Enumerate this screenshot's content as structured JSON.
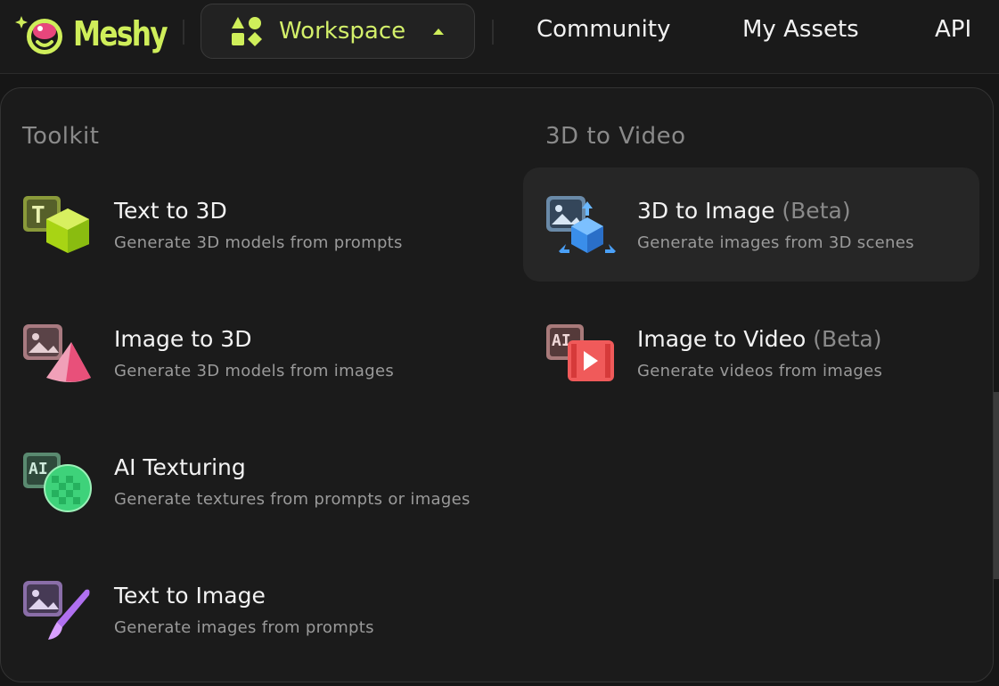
{
  "app": {
    "brand": "Meshy",
    "accent_color": "#cfee5a"
  },
  "nav": {
    "workspace_label": "Workspace",
    "links": [
      "Community",
      "My Assets",
      "API"
    ]
  },
  "menu": {
    "toolkit": {
      "title": "Toolkit",
      "items": [
        {
          "title": "Text to 3D",
          "beta": "",
          "desc": "Generate 3D models from prompts",
          "icon": "text-to-3d-icon"
        },
        {
          "title": "Image to 3D",
          "beta": "",
          "desc": "Generate 3D models from images",
          "icon": "image-to-3d-icon"
        },
        {
          "title": "AI Texturing",
          "beta": "",
          "desc": "Generate textures from prompts or images",
          "icon": "ai-texturing-icon"
        },
        {
          "title": "Text to Image",
          "beta": "",
          "desc": "Generate images from prompts",
          "icon": "text-to-image-icon"
        }
      ]
    },
    "video": {
      "title": "3D to Video",
      "items": [
        {
          "title": "3D to Image",
          "beta": "(Beta)",
          "desc": "Generate images from 3D scenes",
          "icon": "3d-to-image-icon",
          "active": true
        },
        {
          "title": "Image to Video",
          "beta": "(Beta)",
          "desc": "Generate videos from images",
          "icon": "image-to-video-icon"
        }
      ]
    }
  }
}
